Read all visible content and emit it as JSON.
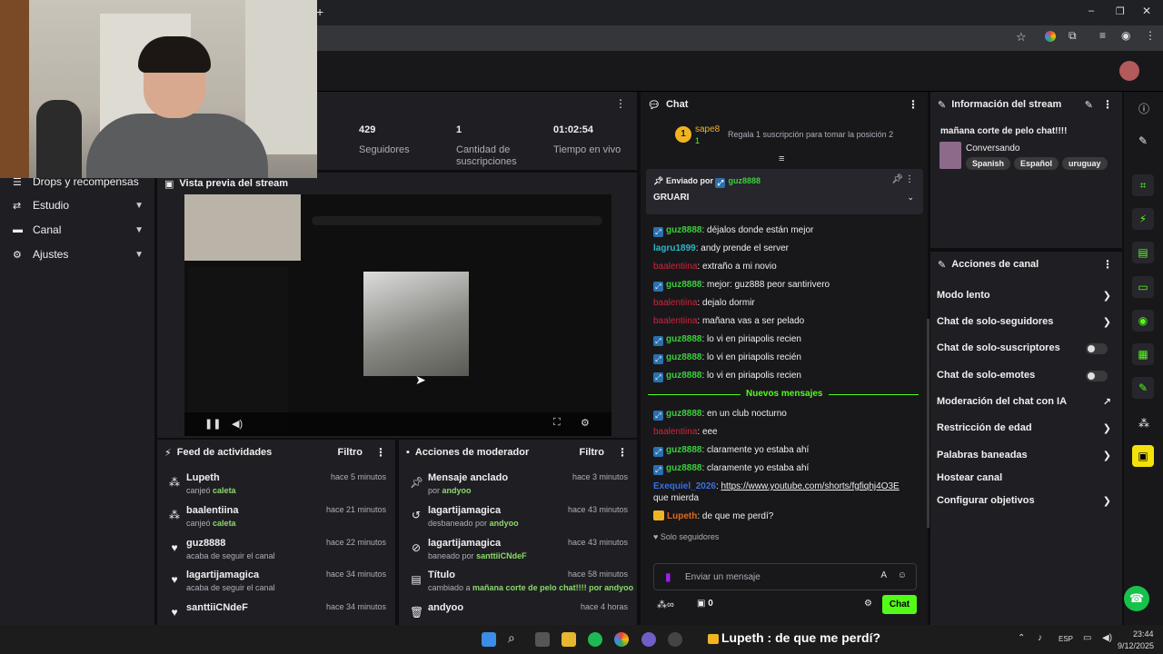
{
  "browser": {
    "new_tab_icon": "plus-icon"
  },
  "sidebar": {
    "items": [
      {
        "label": "Drops y recompensas",
        "icon": "drops-icon"
      },
      {
        "label": "Estudio",
        "icon": "studio-icon"
      },
      {
        "label": "Canal",
        "icon": "channel-icon"
      },
      {
        "label": "Ajustes",
        "icon": "gear-icon"
      }
    ]
  },
  "stats": [
    {
      "value": "429",
      "label": "Seguidores"
    },
    {
      "value": "1",
      "label": "Cantidad de suscripciones"
    },
    {
      "value": "01:02:54",
      "label": "Tiempo en vivo"
    }
  ],
  "preview": {
    "title": "Vista previa del stream"
  },
  "feed": {
    "title": "Feed de actividades",
    "filter": "Filtro",
    "items": [
      {
        "user": "Lupeth",
        "action": "canjeó",
        "target": "caleta",
        "time": "hace 5 minutos"
      },
      {
        "user": "baalentiina",
        "action": "canjeó",
        "target": "caleta",
        "time": "hace 21 minutos"
      },
      {
        "user": "guz8888",
        "action": "acaba de seguir el canal",
        "target": "",
        "time": "hace 22 minutos"
      },
      {
        "user": "lagartijamagica",
        "action": "acaba de seguir el canal",
        "target": "",
        "time": "hace 34 minutos"
      },
      {
        "user": "santtiiCNdeF",
        "action": "",
        "target": "",
        "time": "hace 34 minutos"
      }
    ]
  },
  "mod": {
    "title": "Acciones de moderador",
    "filter": "Filtro",
    "items": [
      {
        "title": "Mensaje anclado",
        "sub": "por",
        "who": "andyoo",
        "time": "hace 3 minutos"
      },
      {
        "title": "lagartijamagica",
        "sub": "desbaneado por",
        "who": "andyoo",
        "time": "hace 43 minutos"
      },
      {
        "title": "lagartijamagica",
        "sub": "baneado por",
        "who": "santtiiCNdeF",
        "time": "hace 43 minutos"
      },
      {
        "title": "Título",
        "sub": "cambiado a",
        "who": "mañana corte de pelo chat!!!! por andyoo",
        "time": "hace 58 minutos"
      },
      {
        "title": "andyoo",
        "sub": "",
        "who": "",
        "time": "hace 4 horas"
      }
    ]
  },
  "chat": {
    "title": "Chat",
    "leader": {
      "rank": "1",
      "name": "sape8",
      "count": "1",
      "gift_text": "Regala 1 suscripción para tomar la posición 2"
    },
    "pinned": {
      "label": "Enviado por",
      "user": "guz8888",
      "text": "GRUARI"
    },
    "messages": [
      {
        "user": "guz8888",
        "text": "déjalos donde están mejor",
        "cls": "u-g",
        "badge": true
      },
      {
        "user": "lagru1899",
        "text": "andy prende el server",
        "cls": "u-c",
        "badge": false
      },
      {
        "user": "baalentiina",
        "text": "extraño a mi novio",
        "cls": "u-r",
        "badge": false
      },
      {
        "user": "guz8888",
        "text": "mejor: guz888 peor santirivero",
        "cls": "u-g",
        "badge": true
      },
      {
        "user": "baalentiina",
        "text": "dejalo dormir",
        "cls": "u-r",
        "badge": false
      },
      {
        "user": "baalentiina",
        "text": "mañana vas a ser pelado",
        "cls": "u-r",
        "badge": false
      },
      {
        "user": "guz8888",
        "text": "lo vi en piriapolis recien",
        "cls": "u-g",
        "badge": true
      },
      {
        "user": "guz8888",
        "text": "lo vi en piriapolis recién",
        "cls": "u-g",
        "badge": true
      },
      {
        "user": "guz8888",
        "text": "lo vi en piriapolis recien",
        "cls": "u-g",
        "badge": true
      }
    ],
    "new_divider": "Nuevos mensajes",
    "new_messages": [
      {
        "user": "guz8888",
        "text": "en un club nocturno",
        "cls": "u-g",
        "badge": true
      },
      {
        "user": "baalentiina",
        "text": "eee",
        "cls": "u-r",
        "badge": false
      },
      {
        "user": "guz8888",
        "text": "claramente yo estaba ahí",
        "cls": "u-g",
        "badge": true
      },
      {
        "user": "guz8888",
        "text": "claramente yo estaba ahí",
        "cls": "u-g",
        "badge": true
      }
    ],
    "link_msg": {
      "user": "Exequiel_2026",
      "link": "https://www.youtube.com/shorts/fgfiqhj4O3E",
      "tail": "que mierda"
    },
    "last_msg": {
      "user": "Lupeth",
      "text": "de que me perdí?"
    },
    "followers_only": "Solo seguidores",
    "input_placeholder": "Enviar un mensaje",
    "points": "0",
    "send_label": "Chat"
  },
  "info": {
    "title": "Información del stream",
    "stream_title": "mañana corte de pelo chat!!!!",
    "category": "Conversando",
    "tags": [
      "Spanish",
      "Español",
      "uruguay"
    ]
  },
  "actions": {
    "title": "Acciones de canal",
    "items": [
      {
        "label": "Modo lento",
        "kind": "arrow"
      },
      {
        "label": "Chat de solo-seguidores",
        "kind": "arrow"
      },
      {
        "label": "Chat de solo-suscriptores",
        "kind": "toggle"
      },
      {
        "label": "Chat de solo-emotes",
        "kind": "toggle"
      },
      {
        "label": "Moderación del chat con IA",
        "kind": "external"
      },
      {
        "label": "Restricción de edad",
        "kind": "arrow"
      },
      {
        "label": "Palabras baneadas",
        "kind": "arrow"
      },
      {
        "label": "Hostear canal",
        "kind": "none"
      },
      {
        "label": "Configurar objetivos",
        "kind": "arrow"
      }
    ]
  },
  "taskbar": {
    "notification": "Lupeth : de que me perdí?",
    "lang": "ESP",
    "time": "23:44",
    "date": "9/12/2025"
  },
  "colors": {
    "accent": "#53fc18",
    "bg": "#18181b"
  }
}
